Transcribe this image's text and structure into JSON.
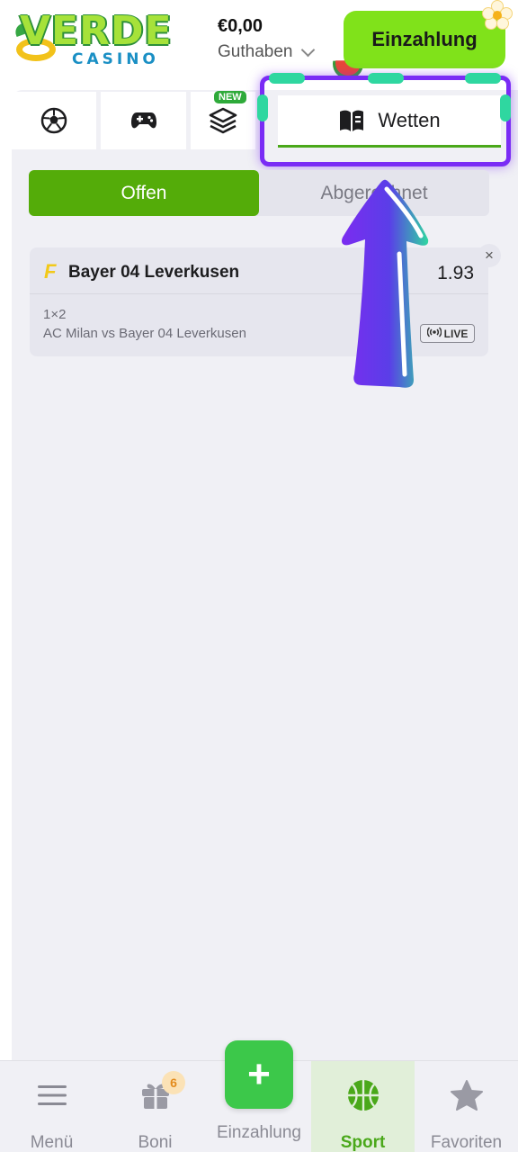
{
  "header": {
    "logo_main": "VERDE",
    "logo_sub": "CASINO",
    "balance_amount": "€0,00",
    "balance_label": "Guthaben",
    "deposit_button": "Einzahlung"
  },
  "tabs": [
    {
      "icon": "soccer-ball-icon"
    },
    {
      "icon": "gamepad-icon"
    },
    {
      "icon": "layers-icon",
      "badge": "NEW"
    },
    {
      "icon": "open-book-icon",
      "label": "Wetten",
      "active": true
    }
  ],
  "segment": {
    "open_label": "Offen",
    "settled_label": "Abgerechnet"
  },
  "bet": {
    "team": "Bayer 04 Leverkusen",
    "odds": "1.93",
    "market": "1×2",
    "match": "AC Milan vs Bayer 04 Leverkusen",
    "live_label": "LIVE",
    "close_symbol": "×"
  },
  "bottom_nav": {
    "menu": "Menü",
    "boni": "Boni",
    "boni_count": "6",
    "deposit": "Einzahlung",
    "deposit_symbol": "+",
    "sport": "Sport",
    "favorites": "Favoriten"
  },
  "colors": {
    "brand_green": "#54ac09",
    "deposit_btn": "#80e21a",
    "highlight_purple": "#7a2cf5",
    "highlight_teal": "#2fd7a0"
  }
}
